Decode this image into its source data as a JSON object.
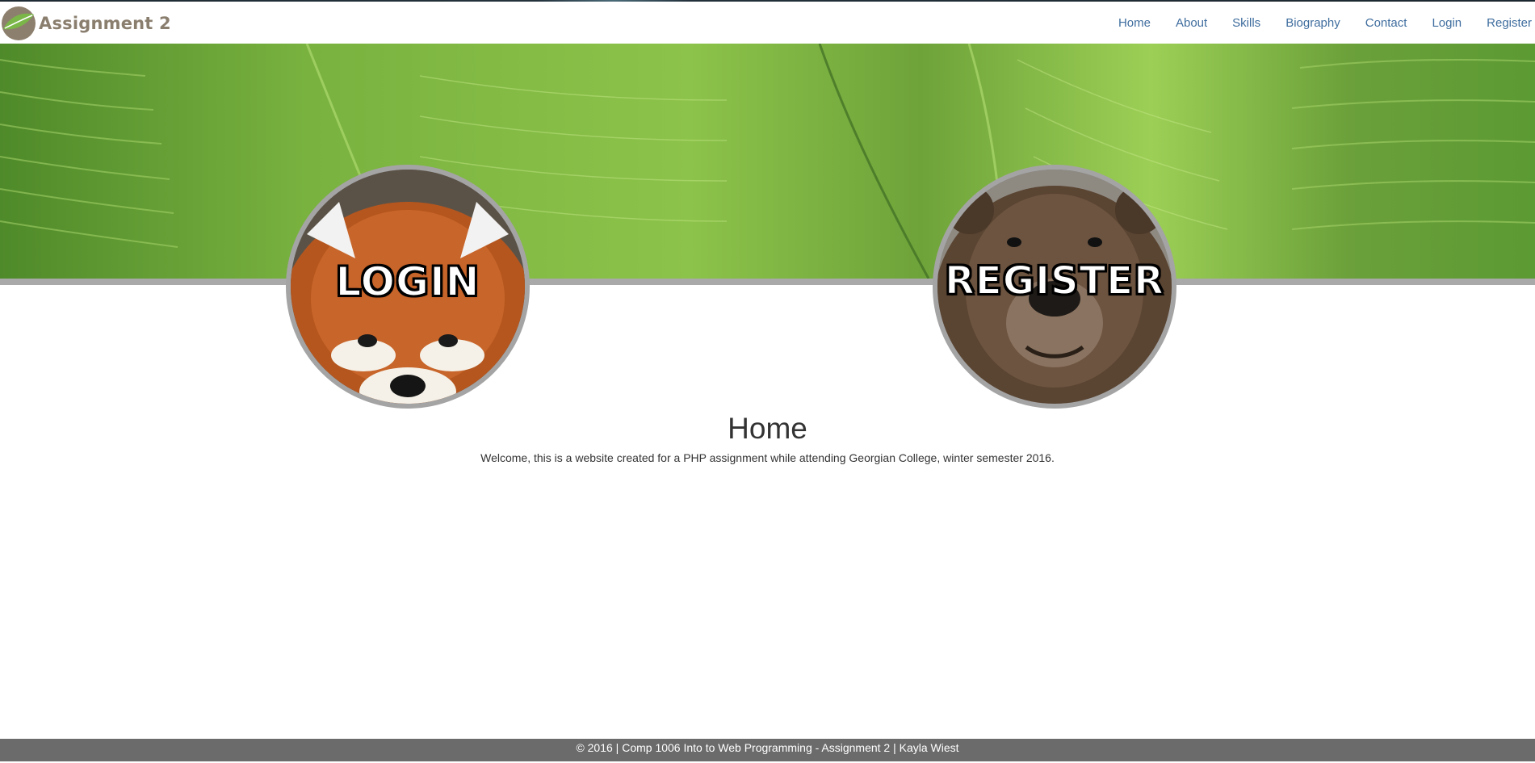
{
  "brand": {
    "title": "Assignment 2"
  },
  "nav": {
    "items": [
      "Home",
      "About",
      "Skills",
      "Biography",
      "Contact",
      "Login",
      "Register"
    ]
  },
  "hero": {
    "login_label": "LOGIN",
    "register_label": "REGISTER"
  },
  "main": {
    "heading": "Home",
    "welcome": "Welcome, this is a website created for a PHP assignment while attending Georgian College, winter semester 2016."
  },
  "footer": {
    "text": "© 2016 | Comp 1006 Into to Web Programming - Assignment 2 | Kayla Wiest"
  },
  "colors": {
    "nav_link": "#3f6d9e",
    "brand": "#8a7e6e",
    "footer_bg": "#6b6b6b",
    "circle_border": "#a4a4a4"
  }
}
